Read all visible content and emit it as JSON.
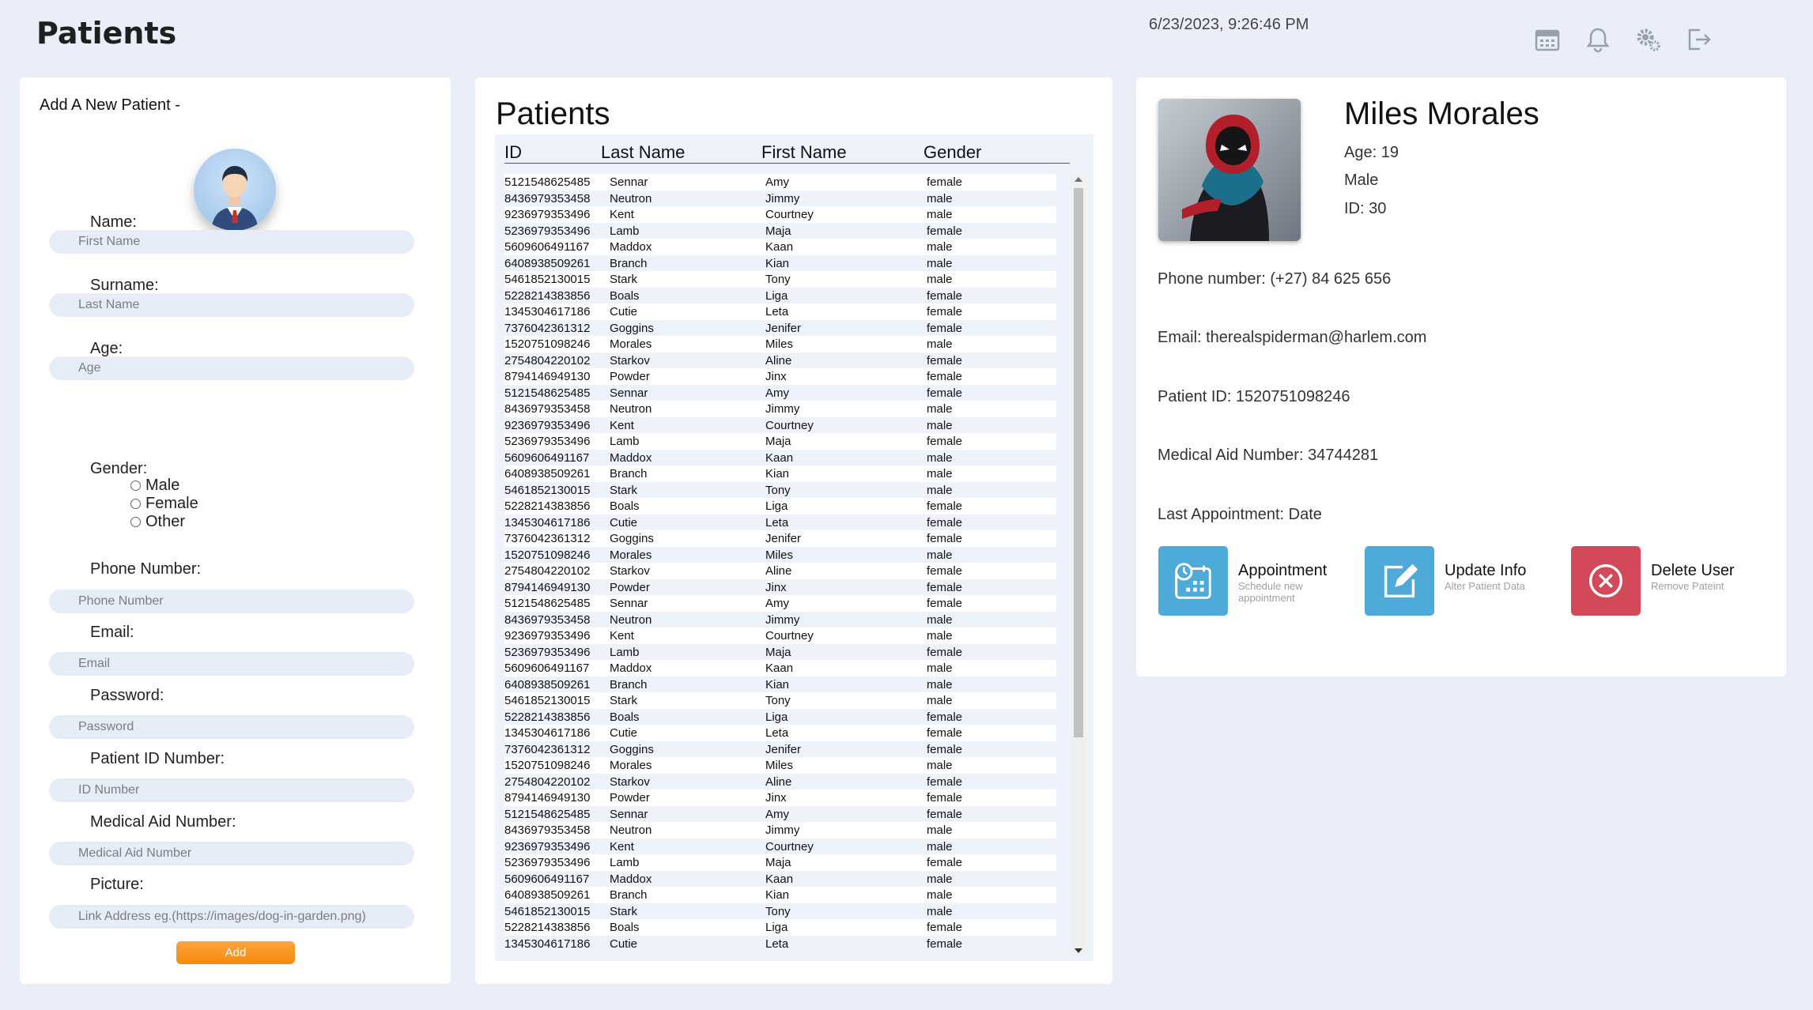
{
  "header": {
    "title": "Patients",
    "datetime": "6/23/2023, 9:26:46 PM",
    "icons": [
      "calendar-icon",
      "bell-icon",
      "gears-icon",
      "logout-icon"
    ]
  },
  "add_form": {
    "heading": "Add A New Patient -",
    "name_label": "Name:",
    "first_name_placeholder": "First Name",
    "surname_label": "Surname:",
    "last_name_placeholder": "Last Name",
    "age_label": "Age:",
    "age_placeholder": "Age",
    "gender_label": "Gender:",
    "gender_options": [
      "Male",
      "Female",
      "Other"
    ],
    "phone_label": "Phone Number:",
    "phone_placeholder": "Phone Number",
    "email_label": "Email:",
    "email_placeholder": "Email",
    "password_label": "Password:",
    "password_placeholder": "Password",
    "patient_id_label": "Patient ID Number:",
    "patient_id_placeholder": "ID Number",
    "medical_aid_label": "Medical Aid Number:",
    "medical_aid_placeholder": "Medical Aid Number",
    "picture_label": "Picture:",
    "picture_placeholder": "Link Address eg.(https://images/dog-in-garden.png)",
    "add_button": "Add"
  },
  "patients_list": {
    "title": "Patients",
    "columns": [
      "ID",
      "Last Name",
      "First Name",
      "Gender"
    ],
    "rows": [
      [
        "5121548625485",
        "Sennar",
        "Amy",
        "female"
      ],
      [
        "8436979353458",
        "Neutron",
        "Jimmy",
        "male"
      ],
      [
        "9236979353496",
        "Kent",
        "Courtney",
        "male"
      ],
      [
        "5236979353496",
        "Lamb",
        "Maja",
        "female"
      ],
      [
        "5609606491167",
        "Maddox",
        "Kaan",
        "male"
      ],
      [
        "6408938509261",
        "Branch",
        "Kian",
        "male"
      ],
      [
        "5461852130015",
        "Stark",
        "Tony",
        "male"
      ],
      [
        "5228214383856",
        "Boals",
        "Liga",
        "female"
      ],
      [
        "1345304617186",
        "Cutie",
        "Leta",
        "female"
      ],
      [
        "7376042361312",
        "Goggins",
        "Jenifer",
        "female"
      ],
      [
        "1520751098246",
        "Morales",
        "Miles",
        "male"
      ],
      [
        "2754804220102",
        "Starkov",
        "Aline",
        "female"
      ],
      [
        "8794146949130",
        "Powder",
        "Jinx",
        "female"
      ],
      [
        "5121548625485",
        "Sennar",
        "Amy",
        "female"
      ],
      [
        "8436979353458",
        "Neutron",
        "Jimmy",
        "male"
      ],
      [
        "9236979353496",
        "Kent",
        "Courtney",
        "male"
      ],
      [
        "5236979353496",
        "Lamb",
        "Maja",
        "female"
      ],
      [
        "5609606491167",
        "Maddox",
        "Kaan",
        "male"
      ],
      [
        "6408938509261",
        "Branch",
        "Kian",
        "male"
      ],
      [
        "5461852130015",
        "Stark",
        "Tony",
        "male"
      ],
      [
        "5228214383856",
        "Boals",
        "Liga",
        "female"
      ],
      [
        "1345304617186",
        "Cutie",
        "Leta",
        "female"
      ],
      [
        "7376042361312",
        "Goggins",
        "Jenifer",
        "female"
      ],
      [
        "1520751098246",
        "Morales",
        "Miles",
        "male"
      ],
      [
        "2754804220102",
        "Starkov",
        "Aline",
        "female"
      ],
      [
        "8794146949130",
        "Powder",
        "Jinx",
        "female"
      ],
      [
        "5121548625485",
        "Sennar",
        "Amy",
        "female"
      ],
      [
        "8436979353458",
        "Neutron",
        "Jimmy",
        "male"
      ],
      [
        "9236979353496",
        "Kent",
        "Courtney",
        "male"
      ],
      [
        "5236979353496",
        "Lamb",
        "Maja",
        "female"
      ],
      [
        "5609606491167",
        "Maddox",
        "Kaan",
        "male"
      ],
      [
        "6408938509261",
        "Branch",
        "Kian",
        "male"
      ],
      [
        "5461852130015",
        "Stark",
        "Tony",
        "male"
      ],
      [
        "5228214383856",
        "Boals",
        "Liga",
        "female"
      ],
      [
        "1345304617186",
        "Cutie",
        "Leta",
        "female"
      ],
      [
        "7376042361312",
        "Goggins",
        "Jenifer",
        "female"
      ],
      [
        "1520751098246",
        "Morales",
        "Miles",
        "male"
      ],
      [
        "2754804220102",
        "Starkov",
        "Aline",
        "female"
      ],
      [
        "8794146949130",
        "Powder",
        "Jinx",
        "female"
      ],
      [
        "5121548625485",
        "Sennar",
        "Amy",
        "female"
      ],
      [
        "8436979353458",
        "Neutron",
        "Jimmy",
        "male"
      ],
      [
        "9236979353496",
        "Kent",
        "Courtney",
        "male"
      ],
      [
        "5236979353496",
        "Lamb",
        "Maja",
        "female"
      ],
      [
        "5609606491167",
        "Maddox",
        "Kaan",
        "male"
      ],
      [
        "6408938509261",
        "Branch",
        "Kian",
        "male"
      ],
      [
        "5461852130015",
        "Stark",
        "Tony",
        "male"
      ],
      [
        "5228214383856",
        "Boals",
        "Liga",
        "female"
      ],
      [
        "1345304617186",
        "Cutie",
        "Leta",
        "female"
      ]
    ]
  },
  "detail": {
    "name": "Miles Morales",
    "age": "Age: 19",
    "gender": "Male",
    "id": "ID: 30",
    "phone": "Phone number: (+27) 84 625 656",
    "email": "Email: therealspiderman@harlem.com",
    "patient_id": "Patient ID: 1520751098246",
    "medical_aid": "Medical Aid Number: 34744281",
    "last_appointment": "Last Appointment: Date",
    "actions": [
      {
        "label": "Appointment",
        "sub": "Schedule new appointment",
        "color": "#4eaad8",
        "icon": "calendar-clock-icon"
      },
      {
        "label": "Update Info",
        "sub": "Alter Patient Data",
        "color": "#4eaad8",
        "icon": "edit-icon"
      },
      {
        "label": "Delete User",
        "sub": "Remove Pateint",
        "color": "#d2495a",
        "icon": "close-circle-icon"
      }
    ]
  }
}
